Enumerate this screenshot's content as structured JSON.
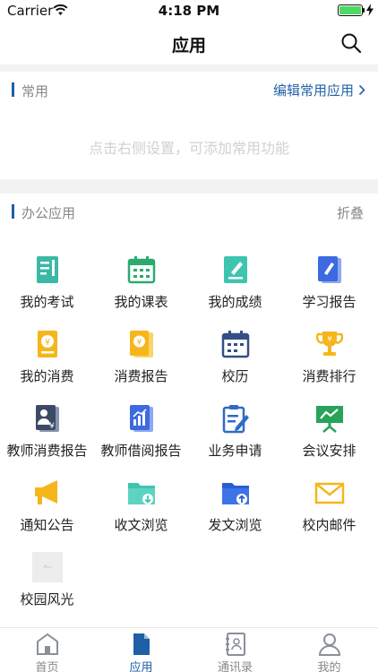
{
  "status_bar": {
    "carrier": "Carrier",
    "time": "4:18 PM"
  },
  "nav": {
    "title": "应用"
  },
  "common": {
    "label": "常用",
    "edit_label": "编辑常用应用",
    "hint": "点击右侧设置，可添加常用功能"
  },
  "office": {
    "label": "办公应用",
    "fold_label": "折叠",
    "apps": [
      {
        "name": "我的考试",
        "icon": "exam-icon"
      },
      {
        "name": "我的课表",
        "icon": "calendar-icon"
      },
      {
        "name": "我的成绩",
        "icon": "grades-icon"
      },
      {
        "name": "学习报告",
        "icon": "study-report-icon"
      },
      {
        "name": "我的消费",
        "icon": "consumption-icon"
      },
      {
        "name": "消费报告",
        "icon": "consumption-report-icon"
      },
      {
        "name": "校历",
        "icon": "school-calendar-icon"
      },
      {
        "name": "消费排行",
        "icon": "trophy-icon"
      },
      {
        "name": "教师消费报告",
        "icon": "teacher-consumption-icon"
      },
      {
        "name": "教师借阅报告",
        "icon": "teacher-borrow-icon"
      },
      {
        "name": "业务申请",
        "icon": "application-icon"
      },
      {
        "name": "会议安排",
        "icon": "meeting-icon"
      },
      {
        "name": "通知公告",
        "icon": "megaphone-icon"
      },
      {
        "name": "收文浏览",
        "icon": "inbox-folder-icon"
      },
      {
        "name": "发文浏览",
        "icon": "outbox-folder-icon"
      },
      {
        "name": "校内邮件",
        "icon": "mail-icon"
      },
      {
        "name": "校园风光",
        "icon": "image-placeholder-icon"
      }
    ]
  },
  "tabs": [
    {
      "label": "首页",
      "icon": "home-icon"
    },
    {
      "label": "应用",
      "icon": "document-icon"
    },
    {
      "label": "通讯录",
      "icon": "contacts-icon"
    },
    {
      "label": "我的",
      "icon": "profile-icon"
    }
  ],
  "colors": {
    "accent": "#1f5fa6",
    "link": "#2463a8",
    "battery": "#4cd964"
  }
}
